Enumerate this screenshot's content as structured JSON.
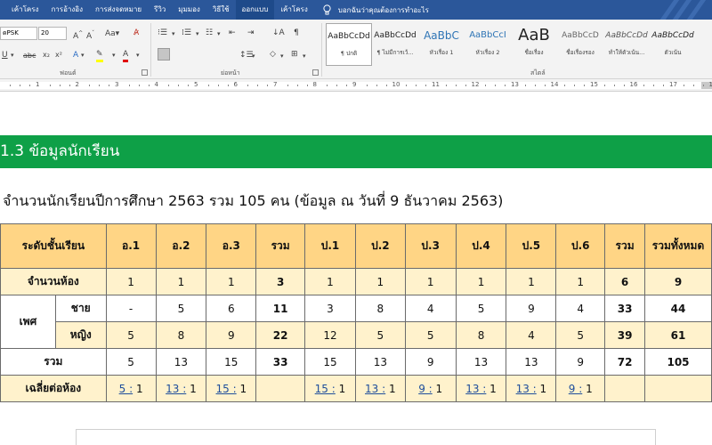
{
  "tabs": [
    "เค้าโครง",
    "การอ้างอิง",
    "การส่งจดหมาย",
    "รีวิว",
    "มุมมอง",
    "วิธีใช้",
    "ออกแบบ",
    "เค้าโครง"
  ],
  "active_tab_index": 6,
  "tell_me": "บอกฉันว่าคุณต้องการทำอะไร",
  "ribbon": {
    "font_name": "ดPSK",
    "font_size": "20",
    "font_group_label": "ฟอนต์",
    "paragraph_group_label": "ย่อหน้า",
    "styles_group_label": "สไตล์",
    "styles": [
      {
        "sample": "AaBbCcDd",
        "name": "¶ ปกติ",
        "selected": true
      },
      {
        "sample": "AaBbCcDd",
        "name": "¶ ไม่มีการเว้...",
        "selected": false
      },
      {
        "sample": "AaBbC",
        "name": "หัวเรื่อง 1",
        "selected": false
      },
      {
        "sample": "AaBbCcI",
        "name": "หัวเรื่อง 2",
        "selected": false
      },
      {
        "sample": "AaB",
        "name": "ชื่อเรื่อง",
        "selected": false
      },
      {
        "sample": "AaBbCcD",
        "name": "ชื่อเรื่องรอง",
        "selected": false
      },
      {
        "sample": "AaBbCcDd",
        "name": "ทำให้ตัวเน้น...",
        "selected": false
      },
      {
        "sample": "AaBbCcDd",
        "name": "ตัวเน้น",
        "selected": false
      }
    ]
  },
  "ruler_numbers": [
    "1",
    "2",
    "3",
    "4",
    "5",
    "6",
    "7",
    "8",
    "9",
    "10",
    "11",
    "12",
    "13",
    "14",
    "15",
    "16",
    "17",
    "18"
  ],
  "document": {
    "section_heading": "1.3 ข้อมูลนักเรียน",
    "subtitle": "จำนวนนักเรียนปีการศึกษา 2563 รวม 105 คน (ข้อมูล ณ วันที่ 9 ธันวาคม 2563)",
    "table": {
      "header": [
        "ระดับชั้นเรียน",
        "อ.1",
        "อ.2",
        "อ.3",
        "รวม",
        "ป.1",
        "ป.2",
        "ป.3",
        "ป.4",
        "ป.5",
        "ป.6",
        "รวม",
        "รวมทั้งหมด"
      ],
      "rooms": {
        "label": "จำนวนห้อง",
        "values": [
          "1",
          "1",
          "1",
          "3",
          "1",
          "1",
          "1",
          "1",
          "1",
          "1",
          "6",
          "9"
        ]
      },
      "gender_label": "เพศ",
      "male": {
        "label": "ชาย",
        "values": [
          "-",
          "5",
          "6",
          "11",
          "3",
          "8",
          "4",
          "5",
          "9",
          "4",
          "33",
          "44"
        ]
      },
      "female": {
        "label": "หญิง",
        "values": [
          "5",
          "8",
          "9",
          "22",
          "12",
          "5",
          "5",
          "8",
          "4",
          "5",
          "39",
          "61"
        ]
      },
      "total": {
        "label": "รวม",
        "values": [
          "5",
          "13",
          "15",
          "33",
          "15",
          "13",
          "9",
          "13",
          "13",
          "9",
          "72",
          "105"
        ]
      },
      "ratio": {
        "label": "เฉลี่ยต่อห้อง",
        "values": [
          {
            "num": "5 :",
            "den": " 1"
          },
          {
            "num": "13 :",
            "den": " 1"
          },
          {
            "num": "15 :",
            "den": " 1"
          },
          {
            "num": "",
            "den": ""
          },
          {
            "num": "15 :",
            "den": " 1"
          },
          {
            "num": "13 :",
            "den": " 1"
          },
          {
            "num": "9 :",
            "den": " 1"
          },
          {
            "num": "13 :",
            "den": " 1"
          },
          {
            "num": "13 :",
            "den": " 1"
          },
          {
            "num": "9 :",
            "den": " 1"
          },
          {
            "num": "",
            "den": ""
          },
          {
            "num": "",
            "den": ""
          }
        ]
      }
    }
  }
}
